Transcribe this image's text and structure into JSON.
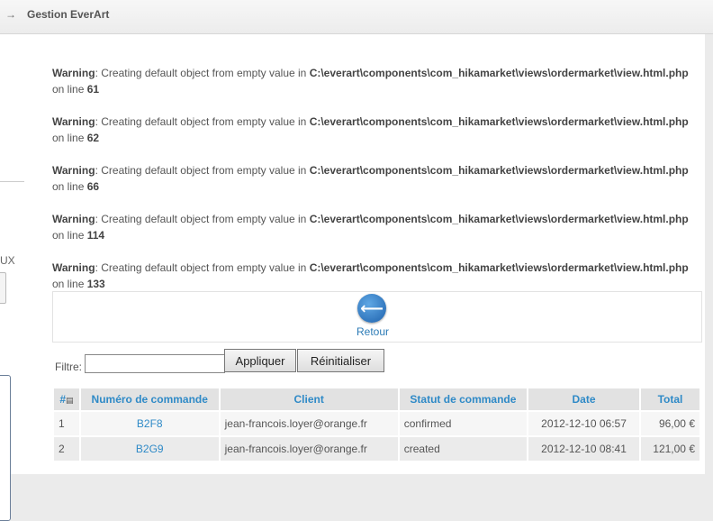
{
  "header": {
    "arrow_icon": "arrow-right-icon",
    "title": "Gestion EverArt"
  },
  "sidebar": {
    "fragment_text": "UX"
  },
  "warnings": [
    {
      "label": "Warning",
      "message": ": Creating default object from empty value in ",
      "path": "C:\\everart\\components\\com_hikamarket\\views\\ordermarket\\view.html.php",
      "on_line": "on line ",
      "line": "61"
    },
    {
      "label": "Warning",
      "message": ": Creating default object from empty value in ",
      "path": "C:\\everart\\components\\com_hikamarket\\views\\ordermarket\\view.html.php",
      "on_line": "on line ",
      "line": "62"
    },
    {
      "label": "Warning",
      "message": ": Creating default object from empty value in ",
      "path": "C:\\everart\\components\\com_hikamarket\\views\\ordermarket\\view.html.php",
      "on_line": "on line ",
      "line": "66"
    },
    {
      "label": "Warning",
      "message": ": Creating default object from empty value in ",
      "path": "C:\\everart\\components\\com_hikamarket\\views\\ordermarket\\view.html.php",
      "on_line": "on line ",
      "line": "114"
    },
    {
      "label": "Warning",
      "message": ": Creating default object from empty value in ",
      "path": "C:\\everart\\components\\com_hikamarket\\views\\ordermarket\\view.html.php",
      "on_line": "on line ",
      "line": "133"
    }
  ],
  "back": {
    "icon": "back-arrow-icon",
    "label": "Retour"
  },
  "filter": {
    "label": "Filtre:",
    "value": "",
    "apply_label": "Appliquer",
    "reset_label": "Réinitialiser"
  },
  "table": {
    "headers": {
      "num": "#",
      "order": "Numéro de commande",
      "client": "Client",
      "status": "Statut de commande",
      "date": "Date",
      "total": "Total"
    },
    "rows": [
      {
        "num": "1",
        "order": "B2F8",
        "client": "jean-francois.loyer@orange.fr",
        "status": "confirmed",
        "date": "2012-12-10 06:57",
        "total": "96,00 €"
      },
      {
        "num": "2",
        "order": "B2G9",
        "client": "jean-francois.loyer@orange.fr",
        "status": "created",
        "date": "2012-12-10 08:41",
        "total": "121,00 €"
      }
    ]
  },
  "colors": {
    "link": "#2f8ac7",
    "header_bg": "#e2e2e2",
    "back_button": "#1e62ad"
  }
}
